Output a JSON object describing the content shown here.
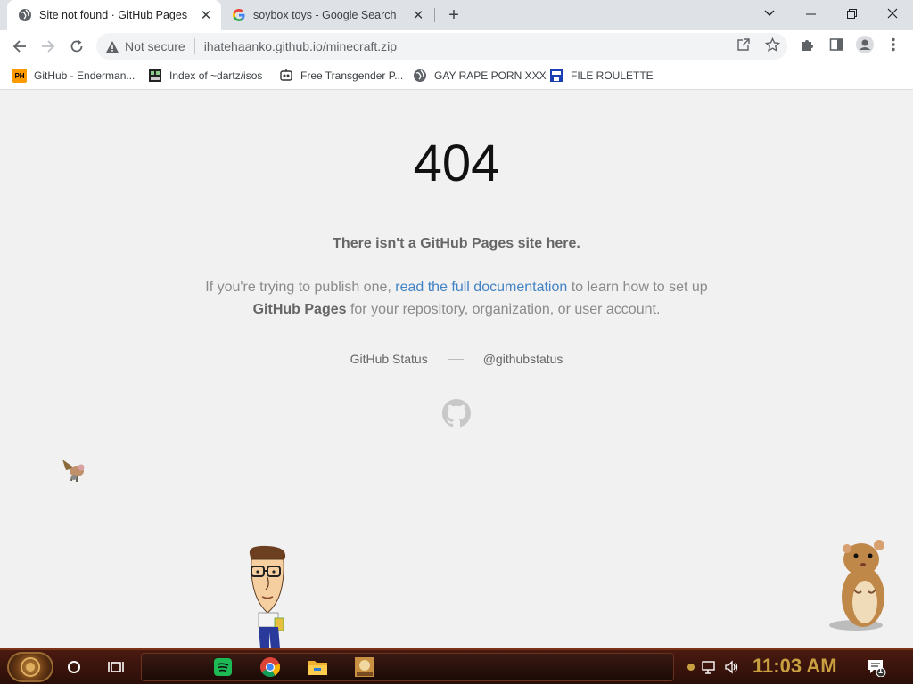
{
  "browser": {
    "tabs": [
      {
        "title": "Site not found · GitHub Pages",
        "active": true,
        "favicon": "globe-icon"
      },
      {
        "title": "soybox toys - Google Search",
        "active": false,
        "favicon": "google-g-icon"
      }
    ],
    "omnibox": {
      "security_label": "Not secure",
      "url": "ihatehaanko.github.io/minecraft.zip"
    },
    "bookmarks": [
      {
        "label": "GitHub - Enderman...",
        "icon": "ph-icon"
      },
      {
        "label": "Index of ~dartz/isos",
        "icon": "folder-icon"
      },
      {
        "label": "Free Transgender P...",
        "icon": "robot-icon"
      },
      {
        "label": "GAY RAPE PORN XXX",
        "icon": "globe-icon"
      },
      {
        "label": "FILE ROULETTE",
        "icon": "file-icon"
      }
    ]
  },
  "page": {
    "heading": "404",
    "subtitle": "There isn't a GitHub Pages site here.",
    "desc_before": "If you're trying to publish one, ",
    "desc_link": "read the full documentation",
    "desc_mid": " to learn how to set up ",
    "desc_strong": "GitHub Pages",
    "desc_after": " for your repository, organization, or user account.",
    "footer_status": "GitHub Status",
    "footer_twitter": "@githubstatus"
  },
  "taskbar": {
    "clock": "11:03 AM",
    "notification_count": "1",
    "apps": [
      "spotify-icon",
      "chrome-icon",
      "file-explorer-icon",
      "game-icon"
    ]
  },
  "colors": {
    "link": "#4183c4",
    "page_bg": "#f1f1f1",
    "tabstrip_bg": "#dee1e6",
    "clock": "#c8a040"
  }
}
